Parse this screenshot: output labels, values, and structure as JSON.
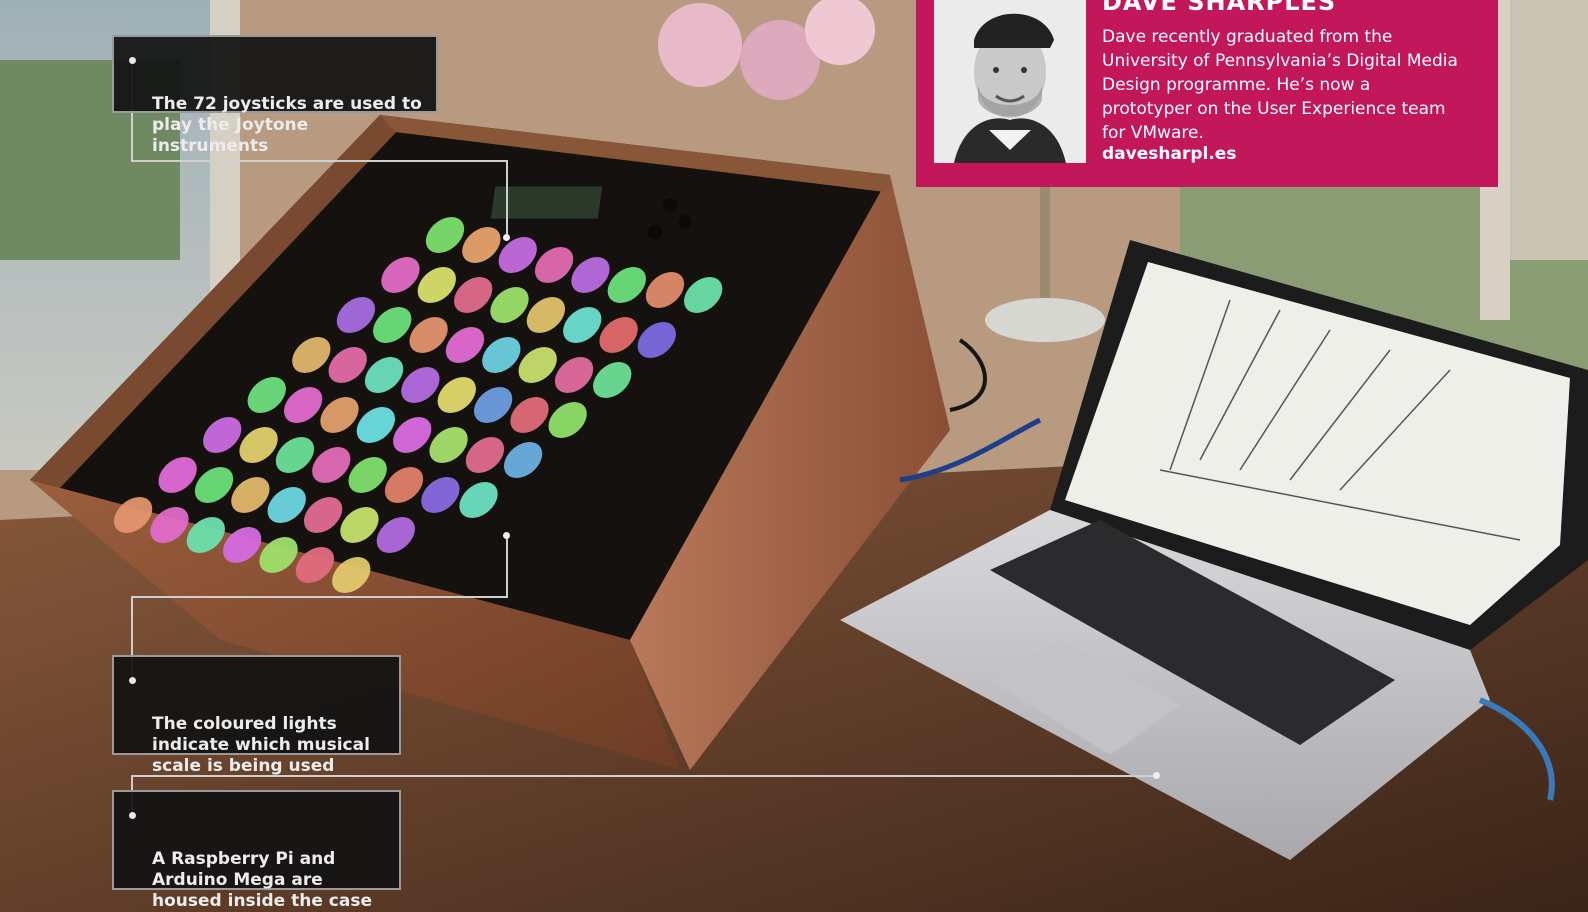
{
  "callouts": {
    "joysticks": "The 72 joysticks are used to\nplay the Joytone instruments",
    "lights": "The coloured lights\nindicate which musical\nscale is being used",
    "hardware": "A Raspberry Pi and\nArduino Mega are\nhoused inside the case"
  },
  "bio": {
    "name": "DAVE SHARPLES",
    "text": "Dave recently graduated from the University of Pennsylvania’s Digital Media Design programme. He’s now a prototyper on the User Experience team for VMware.",
    "link": "davesharpl.es"
  },
  "colors": {
    "accent": "#c2185b",
    "callout_bg": "#121212",
    "callout_border": "#9a9a9a"
  }
}
